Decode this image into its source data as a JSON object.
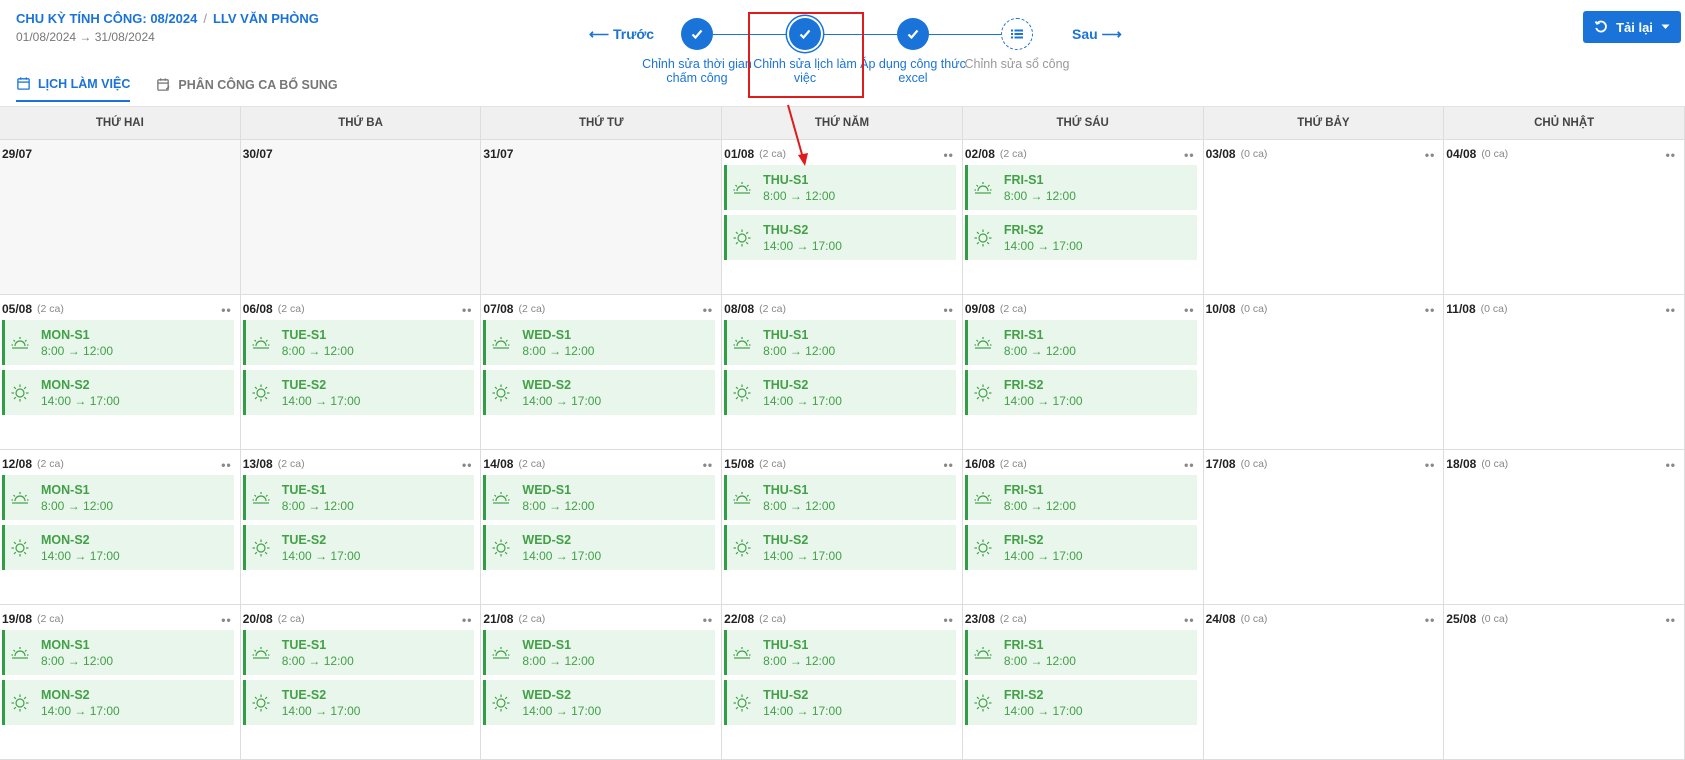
{
  "breadcrumb": {
    "cycle": "CHU KỲ TÍNH CÔNG: 08/2024",
    "separator": "/",
    "schedule": "LLV VĂN PHÒNG"
  },
  "period": "01/08/2024 → 31/08/2024",
  "tabs": [
    {
      "label": "LỊCH LÀM VIỆC",
      "icon": "calendar-icon",
      "active": true
    },
    {
      "label": "PHÂN CÔNG CA BỔ SUNG",
      "icon": "calendar-edit-icon",
      "active": false
    }
  ],
  "nav": {
    "prev": "⟵ Trước",
    "next": "Sau ⟶"
  },
  "steps": [
    {
      "label": "Chỉnh sửa thời gian chấm công",
      "state": "done"
    },
    {
      "label": "Chỉnh sửa lịch làm việc",
      "state": "current"
    },
    {
      "label": "Áp dụng công thức excel",
      "state": "done"
    },
    {
      "label": "Chỉnh sửa sổ công",
      "state": "pending"
    }
  ],
  "reload_button": {
    "label": "Tải lại",
    "icon": "refresh-icon"
  },
  "weekdays": [
    "THỨ HAI",
    "THỨ BA",
    "THỨ TƯ",
    "THỨ NĂM",
    "THỨ SÁU",
    "THỨ BẢY",
    "CHỦ NHẬT"
  ],
  "shift_templates": {
    "morning_time": "8:00 → 12:00",
    "afternoon_time": "14:00 → 17:00"
  },
  "weeks": [
    [
      {
        "date": "29/07",
        "past": true
      },
      {
        "date": "30/07",
        "past": true
      },
      {
        "date": "31/07",
        "past": true
      },
      {
        "date": "01/08",
        "count": "(2 ca)",
        "code": "THU"
      },
      {
        "date": "02/08",
        "count": "(2 ca)",
        "code": "FRI"
      },
      {
        "date": "03/08",
        "count": "(0 ca)"
      },
      {
        "date": "04/08",
        "count": "(0 ca)"
      }
    ],
    [
      {
        "date": "05/08",
        "count": "(2 ca)",
        "code": "MON"
      },
      {
        "date": "06/08",
        "count": "(2 ca)",
        "code": "TUE"
      },
      {
        "date": "07/08",
        "count": "(2 ca)",
        "code": "WED"
      },
      {
        "date": "08/08",
        "count": "(2 ca)",
        "code": "THU"
      },
      {
        "date": "09/08",
        "count": "(2 ca)",
        "code": "FRI"
      },
      {
        "date": "10/08",
        "count": "(0 ca)"
      },
      {
        "date": "11/08",
        "count": "(0 ca)"
      }
    ],
    [
      {
        "date": "12/08",
        "count": "(2 ca)",
        "code": "MON"
      },
      {
        "date": "13/08",
        "count": "(2 ca)",
        "code": "TUE"
      },
      {
        "date": "14/08",
        "count": "(2 ca)",
        "code": "WED"
      },
      {
        "date": "15/08",
        "count": "(2 ca)",
        "code": "THU"
      },
      {
        "date": "16/08",
        "count": "(2 ca)",
        "code": "FRI"
      },
      {
        "date": "17/08",
        "count": "(0 ca)"
      },
      {
        "date": "18/08",
        "count": "(0 ca)"
      }
    ],
    [
      {
        "date": "19/08",
        "count": "(2 ca)",
        "code": "MON"
      },
      {
        "date": "20/08",
        "count": "(2 ca)",
        "code": "TUE"
      },
      {
        "date": "21/08",
        "count": "(2 ca)",
        "code": "WED"
      },
      {
        "date": "22/08",
        "count": "(2 ca)",
        "code": "THU"
      },
      {
        "date": "23/08",
        "count": "(2 ca)",
        "code": "FRI"
      },
      {
        "date": "24/08",
        "count": "(0 ca)"
      },
      {
        "date": "25/08",
        "count": "(0 ca)"
      }
    ]
  ],
  "colors": {
    "primary": "#1a73d9",
    "shift_bg": "#e8f6ec",
    "shift_text": "#43a047",
    "annotation": "#e01b1b"
  }
}
